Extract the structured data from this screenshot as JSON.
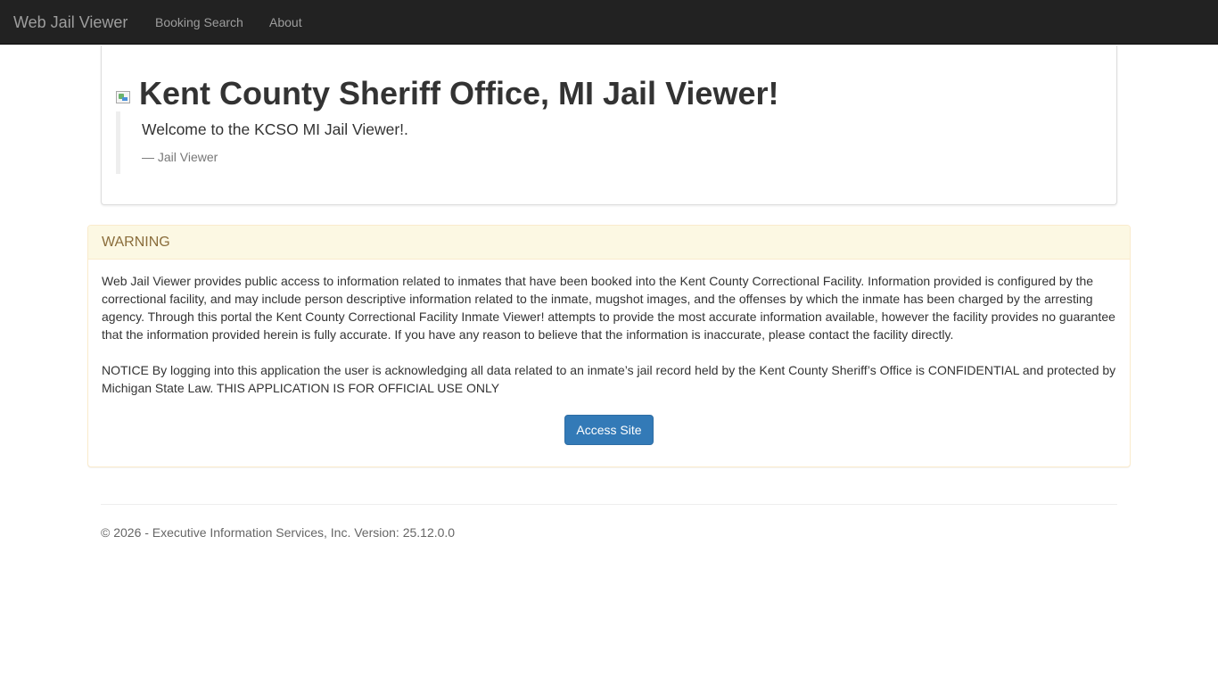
{
  "navbar": {
    "brand": "Web Jail Viewer",
    "links": [
      "Booking Search",
      "About"
    ]
  },
  "jumbotron": {
    "logo_icon": "broken-image-icon",
    "title": "Kent County Sheriff Office, MI Jail Viewer!",
    "quote": "Welcome to the KCSO MI Jail Viewer!.",
    "quote_footer": "— Jail Viewer"
  },
  "warning_panel": {
    "heading": "WARNING",
    "paragraph1": "Web Jail Viewer provides public access to information related to inmates that have been booked into the Kent County Correctional Facility. Information provided is configured by the correctional facility, and may include person descriptive information related to the inmate, mugshot images, and the offenses by which the inmate has been charged by the arresting agency. Through this portal the Kent County Correctional Facility Inmate Viewer! attempts to provide the most accurate information available, however the facility provides no guarantee that the information provided herein is fully accurate. If you have any reason to believe that the information is inaccurate, please contact the facility directly.",
    "paragraph2": "NOTICE By logging into this application the user is acknowledging all data related to an inmate’s jail record held by the Kent County Sheriff’s Office is CONFIDENTIAL and protected by Michigan State Law. THIS APPLICATION IS FOR OFFICIAL USE ONLY",
    "button_label": "Access Site"
  },
  "footer": {
    "text": "© 2026 - Executive Information Services, Inc. Version: 25.12.0.0"
  },
  "colors": {
    "navbar_bg": "#222222",
    "warning_bg": "#fcf8e3",
    "warning_text": "#8a6d3b",
    "primary_button": "#337ab7"
  }
}
